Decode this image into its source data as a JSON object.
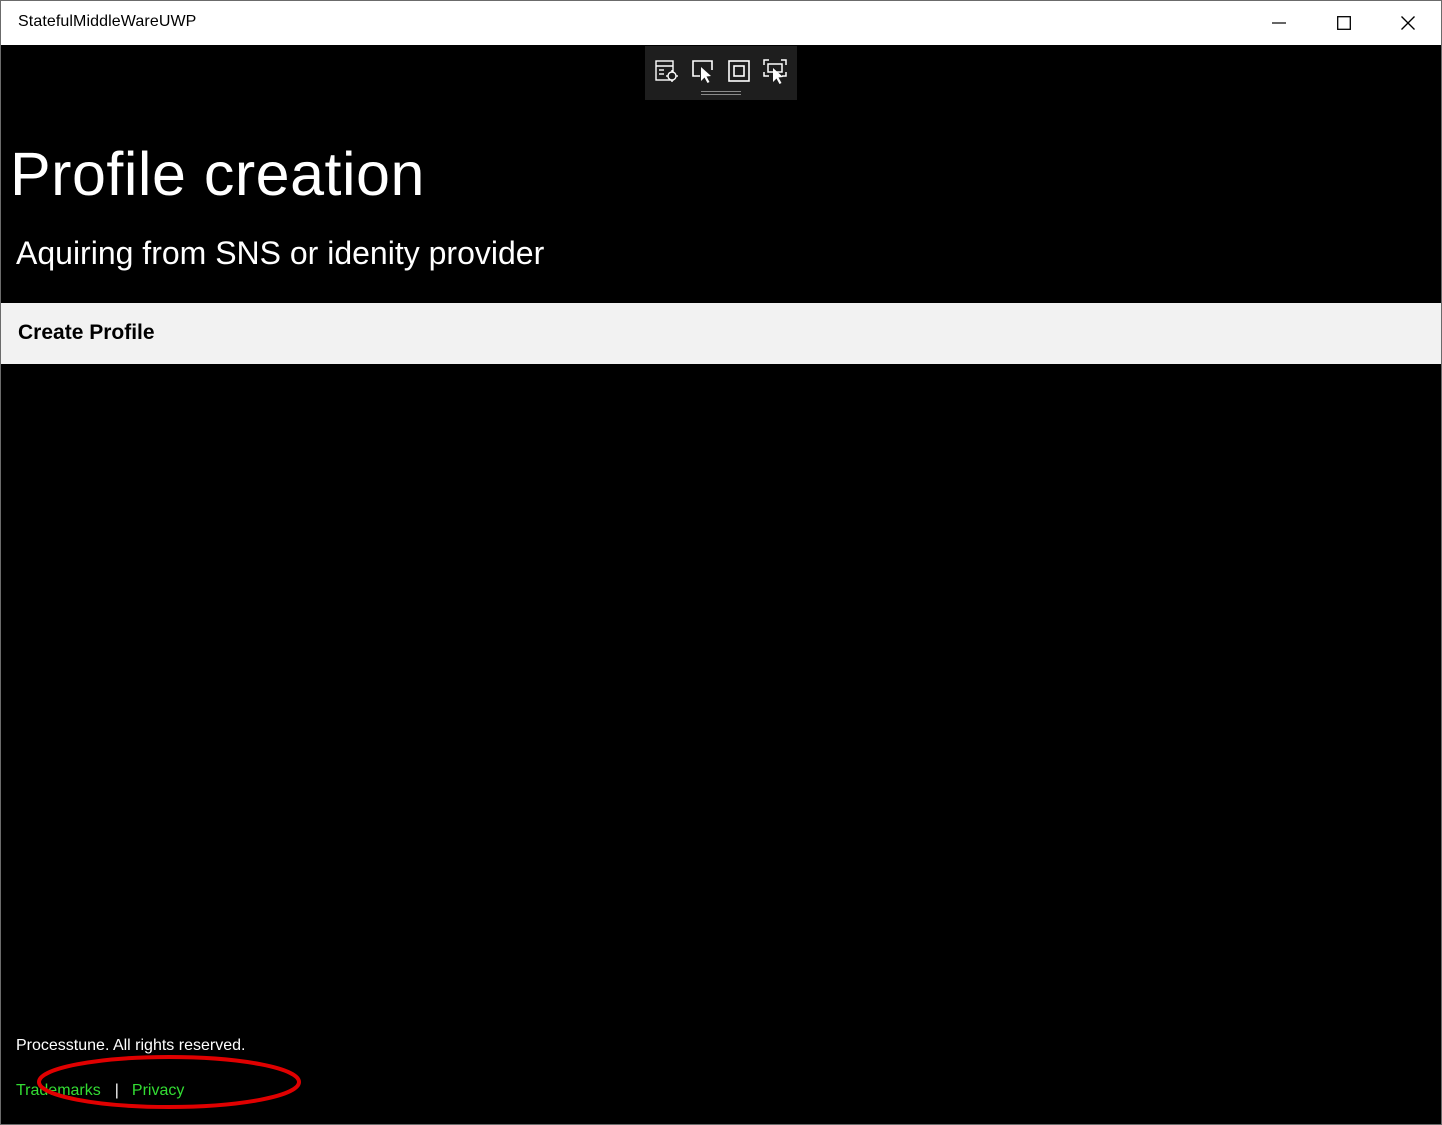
{
  "window": {
    "title": "StatefulMiddleWareUWP",
    "controls": {
      "minimize": "minimize-icon",
      "maximize": "maximize-icon",
      "close": "close-icon"
    }
  },
  "debug_toolbar": {
    "icons": [
      "live-visual-tree-icon",
      "select-element-icon",
      "display-layout-adorners-icon",
      "track-focused-element-icon"
    ]
  },
  "page": {
    "title": "Profile creation",
    "subtitle": "Aquiring from SNS or idenity provider",
    "create_button_label": "Create Profile"
  },
  "footer": {
    "copyright": "Processtune. All rights reserved.",
    "trademarks_label": "Trademarks",
    "separator": "|",
    "privacy_label": "Privacy"
  },
  "colors": {
    "background": "#000000",
    "titlebar": "#ffffff",
    "create_bar": "#f2f2f2",
    "link": "#33dd33",
    "annotation_ellipse": "#e00000"
  }
}
